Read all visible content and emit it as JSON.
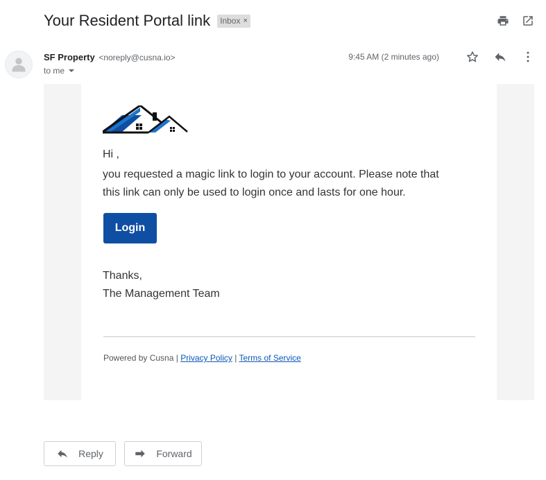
{
  "header": {
    "subject": "Your Resident Portal link",
    "label": "Inbox",
    "label_remove": "×"
  },
  "icons": {
    "print": "print-icon",
    "popout": "open-in-new-window-icon",
    "star": "star-icon",
    "reply": "reply-icon",
    "more": "more-vertical-icon",
    "forward": "forward-icon"
  },
  "message": {
    "sender_name": "SF Property",
    "sender_email": "<noreply@cusna.io>",
    "recipient": "to me",
    "time": "9:45 AM (2 minutes ago)"
  },
  "email": {
    "greeting": "Hi ,",
    "body_line1": "you requested a magic link to login to your account. Please note that",
    "body_line2": "this link can only be used to login once and lasts for one hour.",
    "login_label": "Login",
    "thanks": "Thanks,",
    "signature": "The Management Team",
    "footer": {
      "powered": "Powered by Cusna",
      "sep": "|",
      "privacy": "Privacy Policy",
      "terms": "Terms of Service"
    }
  },
  "actions": {
    "reply_label": "Reply",
    "forward_label": "Forward"
  },
  "colors": {
    "accent": "#0f4fa3",
    "link": "#0b57b5",
    "panel_bg": "#f4f4f4"
  }
}
